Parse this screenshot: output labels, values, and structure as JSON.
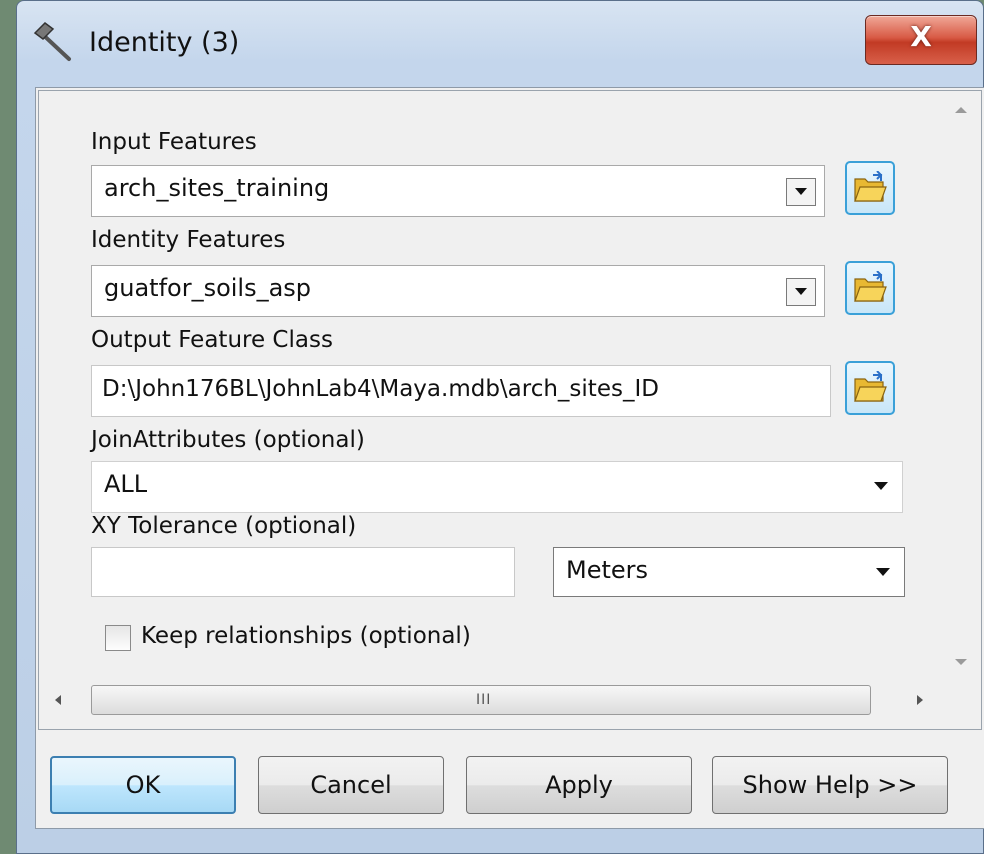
{
  "window": {
    "title": "Identity (3)",
    "close_label": "X"
  },
  "form": {
    "input_features": {
      "label": "Input Features",
      "value": "arch_sites_training"
    },
    "identity_features": {
      "label": "Identity Features",
      "value": "guatfor_soils_asp"
    },
    "output_feature_class": {
      "label": "Output Feature Class",
      "value": "D:\\John176BL\\JohnLab4\\Maya.mdb\\arch_sites_ID"
    },
    "join_attributes": {
      "label": "JoinAttributes (optional)",
      "value": "ALL"
    },
    "xy_tolerance": {
      "label": "XY Tolerance (optional)",
      "value": "",
      "units": "Meters"
    },
    "keep_relationships": {
      "label": "Keep relationships (optional)",
      "checked": false
    }
  },
  "scroll": {
    "grip": "III"
  },
  "buttons": {
    "ok": "OK",
    "cancel": "Cancel",
    "apply": "Apply",
    "help": "Show Help >>"
  },
  "icons": {
    "title": "hammer-icon",
    "browse": "open-folder-icon"
  }
}
